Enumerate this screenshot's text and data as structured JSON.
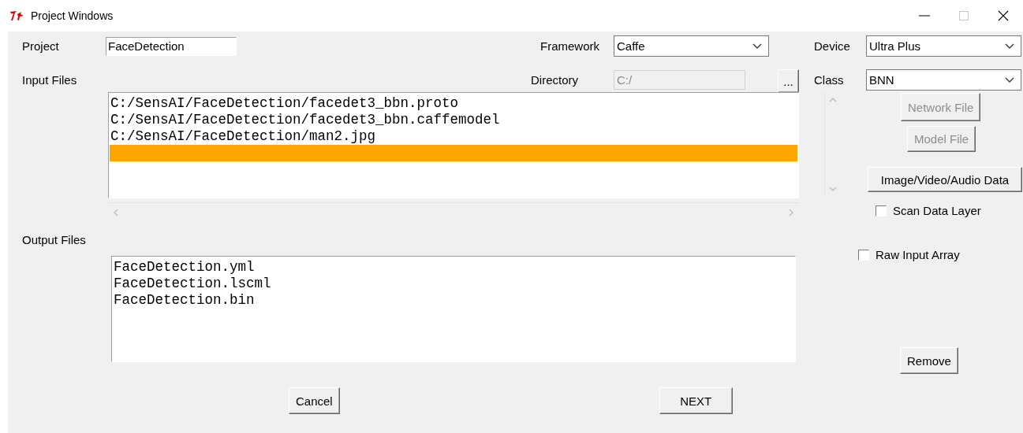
{
  "window": {
    "title": "Project Windows"
  },
  "project": {
    "label": "Project",
    "value": "FaceDetection"
  },
  "framework": {
    "label": "Framework",
    "value": "Caffe"
  },
  "device": {
    "label": "Device",
    "value": "Ultra Plus"
  },
  "input_files": {
    "label": "Input Files"
  },
  "directory": {
    "label": "Directory",
    "value": "C:/",
    "disabled": true,
    "browse_button": "..."
  },
  "class": {
    "label": "Class",
    "value": "BNN"
  },
  "input_list": {
    "items": [
      {
        "text": "C:/SensAI/FaceDetection/facedet3_bbn.proto",
        "selected": false
      },
      {
        "text": "C:/SensAI/FaceDetection/facedet3_bbn.caffemodel",
        "selected": false
      },
      {
        "text": "C:/SensAI/FaceDetection/man2.jpg",
        "selected": false
      }
    ],
    "empty_row": {
      "selected": true
    }
  },
  "side_buttons": [
    {
      "label": "Network File",
      "disabled": true
    },
    {
      "label": "Model File",
      "disabled": true
    },
    {
      "label": "Image/Video/Audio Data",
      "disabled": false
    }
  ],
  "scan_data_layer": {
    "label": "Scan Data Layer",
    "checked": false
  },
  "output_files": {
    "label": "Output Files",
    "items": [
      "FaceDetection.yml",
      "FaceDetection.lscml",
      "FaceDetection.bin"
    ]
  },
  "raw_input_array": {
    "label": "Raw Input Array",
    "checked": false
  },
  "remove_button": "Remove",
  "cancel_button": "Cancel",
  "next_button": "NEXT"
}
